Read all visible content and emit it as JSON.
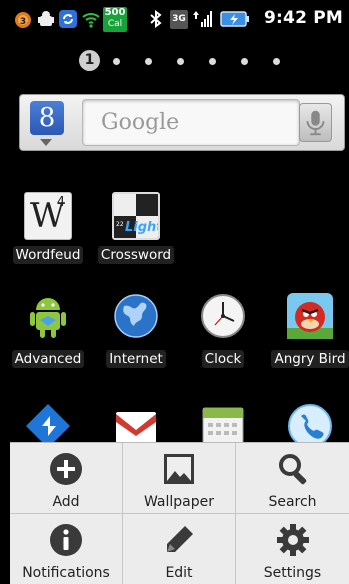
{
  "status_bar": {
    "data_badge_top": "500",
    "data_badge_bottom": "Cal",
    "network_label": "3G",
    "time": "9:42 PM"
  },
  "pager": {
    "current_page": "1",
    "total_pages": 7
  },
  "search_widget": {
    "placeholder": "Google",
    "logo_letter": "8"
  },
  "apps_row1": [
    {
      "label": "Wordfeud",
      "icon": "wordfeud-icon"
    },
    {
      "label": "Crossword",
      "icon": "crossword-icon"
    }
  ],
  "apps_row2": [
    {
      "label": "Advanced",
      "icon": "android-robot-icon"
    },
    {
      "label": "Internet",
      "icon": "globe-icon"
    },
    {
      "label": "Clock",
      "icon": "clock-icon"
    },
    {
      "label": "Angry Bird",
      "icon": "angry-bird-icon"
    }
  ],
  "apps_row3": [
    {
      "icon": "navigation-icon"
    },
    {
      "icon": "gmail-icon"
    },
    {
      "icon": "calendar-icon"
    },
    {
      "icon": "phone-icon"
    }
  ],
  "wordfeud_tile": {
    "letter": "W",
    "score": "4"
  },
  "crossword_tile": {
    "mark": "22",
    "word": "Light"
  },
  "menu": {
    "items": [
      {
        "label": "Add",
        "icon": "plus-icon"
      },
      {
        "label": "Wallpaper",
        "icon": "picture-icon"
      },
      {
        "label": "Search",
        "icon": "magnifier-icon"
      },
      {
        "label": "Notifications",
        "icon": "info-icon"
      },
      {
        "label": "Edit",
        "icon": "pencil-icon"
      },
      {
        "label": "Settings",
        "icon": "gear-icon"
      }
    ]
  }
}
